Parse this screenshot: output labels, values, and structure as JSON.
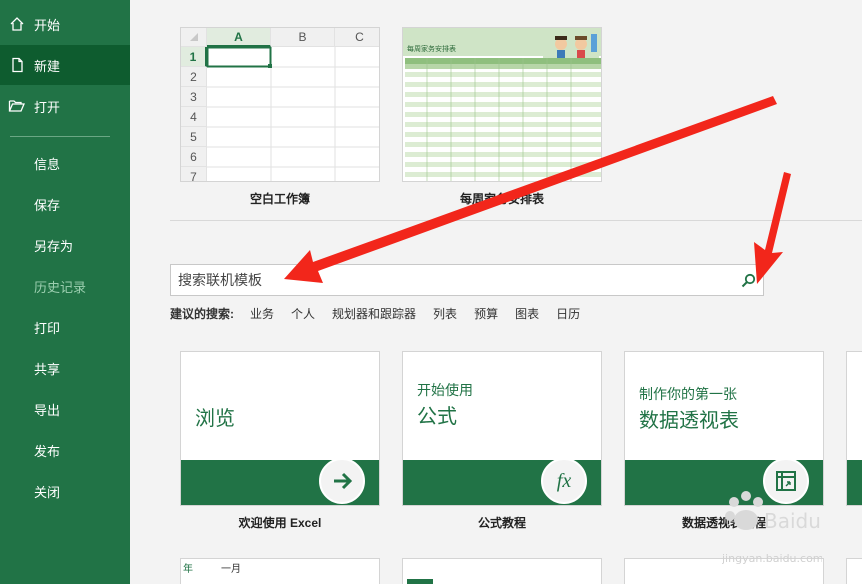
{
  "sidebar": {
    "items": [
      {
        "label": "开始",
        "icon": "home-icon"
      },
      {
        "label": "新建",
        "icon": "new-document-icon"
      },
      {
        "label": "打开",
        "icon": "folder-open-icon"
      },
      {
        "label": "信息"
      },
      {
        "label": "保存"
      },
      {
        "label": "另存为"
      },
      {
        "label": "历史记录"
      },
      {
        "label": "打印"
      },
      {
        "label": "共享"
      },
      {
        "label": "导出"
      },
      {
        "label": "发布"
      },
      {
        "label": "关闭"
      }
    ]
  },
  "featured": {
    "blank": {
      "caption": "空白工作簿",
      "columns": [
        "A",
        "B",
        "C"
      ],
      "rows": [
        "1",
        "2",
        "3",
        "4",
        "5",
        "6",
        "7"
      ]
    },
    "weekly": {
      "caption": "每周家务安排表",
      "title": "每周家务安排表"
    }
  },
  "search": {
    "placeholder": "搜索联机模板",
    "suggest_label": "建议的搜索:",
    "suggestions": [
      "业务",
      "个人",
      "规划器和跟踪器",
      "列表",
      "预算",
      "图表",
      "日历"
    ]
  },
  "cards": [
    {
      "small": "",
      "big": "浏览",
      "caption": "欢迎使用 Excel",
      "icon": "arrow-right-icon"
    },
    {
      "small": "开始使用",
      "big": "公式",
      "caption": "公式教程",
      "icon": "fx-icon"
    },
    {
      "small": "制作你的第一张",
      "big": "数据透视表",
      "caption": "数据透视表教程",
      "icon": "pivot-table-icon"
    }
  ],
  "partials": {
    "calendar_year": "年",
    "calendar_month": "一月"
  },
  "watermark": {
    "line1": "Baidu 经验",
    "line2": "jingyan.baidu.com"
  },
  "colors": {
    "accent": "#217346",
    "accent_dark": "#0e5c2f",
    "arrow": "#f2261b"
  }
}
